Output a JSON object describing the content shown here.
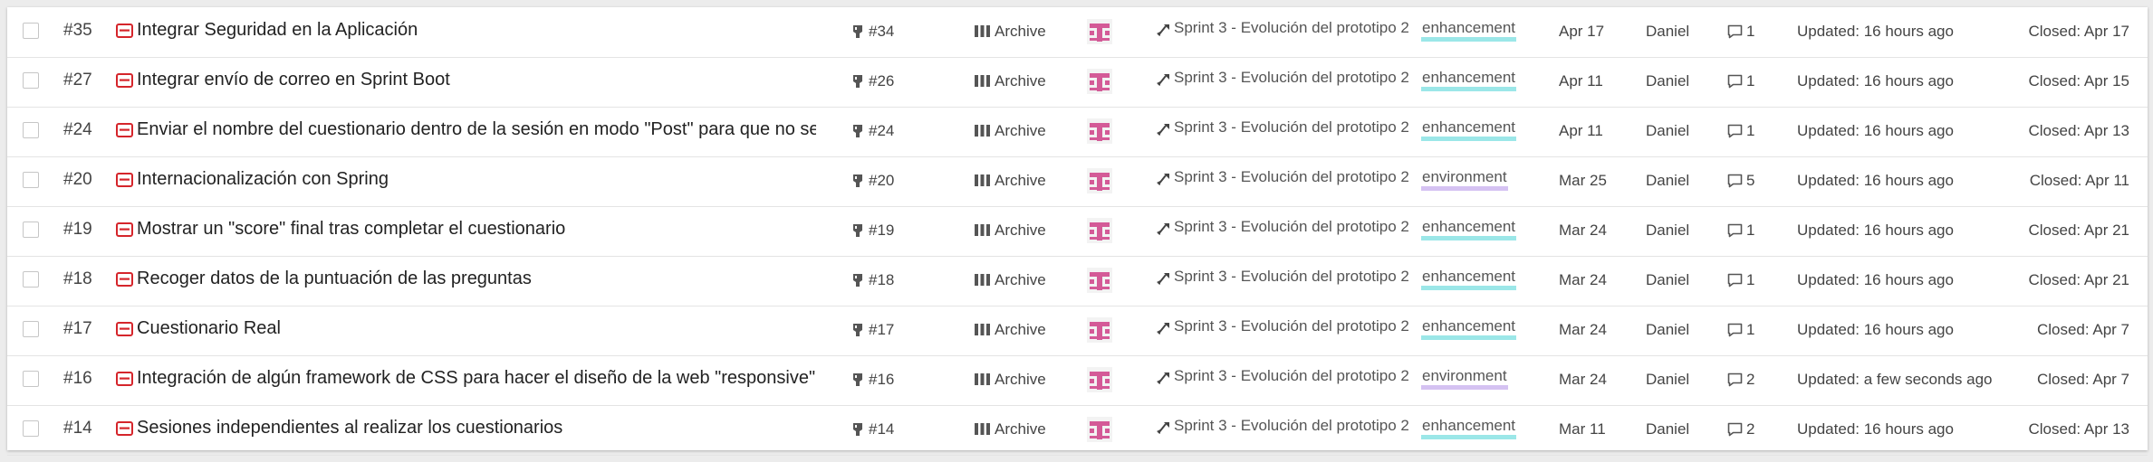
{
  "colors": {
    "issue_icon": "#d5252b",
    "label_enhancement": "#9be7e8",
    "label_environment": "#d5c2f2",
    "avatar": "#d45a97"
  },
  "icons": {
    "issue": "issue-icon",
    "branch": "branch-icon",
    "column": "board-column-icon",
    "milestone": "milestone-icon",
    "comment": "comment-icon"
  },
  "issues": [
    {
      "number": "#35",
      "title": "Integrar Seguridad en la Aplicación",
      "branch": "#34",
      "column": "Archive",
      "milestone": "Sprint 3 - Evolución del prototipo 2",
      "label": "enhancement",
      "date": "Apr 17",
      "author": "Daniel",
      "comments": "1",
      "updated": "Updated: 16 hours ago",
      "closed": "Closed: Apr 17"
    },
    {
      "number": "#27",
      "title": "Integrar envío de correo en Sprint Boot",
      "branch": "#26",
      "column": "Archive",
      "milestone": "Sprint 3 - Evolución del prototipo 2",
      "label": "enhancement",
      "date": "Apr 11",
      "author": "Daniel",
      "comments": "1",
      "updated": "Updated: 16 hours ago",
      "closed": "Closed: Apr 15"
    },
    {
      "number": "#24",
      "title": "Enviar el nombre del cuestionario dentro de la sesión en modo \"Post\" para que no se",
      "branch": "#24",
      "column": "Archive",
      "milestone": "Sprint 3 - Evolución del prototipo 2",
      "label": "enhancement",
      "date": "Apr 11",
      "author": "Daniel",
      "comments": "1",
      "updated": "Updated: 16 hours ago",
      "closed": "Closed: Apr 13"
    },
    {
      "number": "#20",
      "title": "Internacionalización con Spring",
      "branch": "#20",
      "column": "Archive",
      "milestone": "Sprint 3 - Evolución del prototipo 2",
      "label": "environment",
      "date": "Mar 25",
      "author": "Daniel",
      "comments": "5",
      "updated": "Updated: 16 hours ago",
      "closed": "Closed: Apr 11"
    },
    {
      "number": "#19",
      "title": "Mostrar un \"score\" final tras completar el cuestionario",
      "branch": "#19",
      "column": "Archive",
      "milestone": "Sprint 3 - Evolución del prototipo 2",
      "label": "enhancement",
      "date": "Mar 24",
      "author": "Daniel",
      "comments": "1",
      "updated": "Updated: 16 hours ago",
      "closed": "Closed: Apr 21"
    },
    {
      "number": "#18",
      "title": "Recoger datos de la puntuación de las preguntas",
      "branch": "#18",
      "column": "Archive",
      "milestone": "Sprint 3 - Evolución del prototipo 2",
      "label": "enhancement",
      "date": "Mar 24",
      "author": "Daniel",
      "comments": "1",
      "updated": "Updated: 16 hours ago",
      "closed": "Closed: Apr 21"
    },
    {
      "number": "#17",
      "title": "Cuestionario Real",
      "branch": "#17",
      "column": "Archive",
      "milestone": "Sprint 3 - Evolución del prototipo 2",
      "label": "enhancement",
      "date": "Mar 24",
      "author": "Daniel",
      "comments": "1",
      "updated": "Updated: 16 hours ago",
      "closed": "Closed: Apr 7"
    },
    {
      "number": "#16",
      "title": "Integración de algún framework de CSS para hacer el diseño de la web \"responsive\"",
      "branch": "#16",
      "column": "Archive",
      "milestone": "Sprint 3 - Evolución del prototipo 2",
      "label": "environment",
      "date": "Mar 24",
      "author": "Daniel",
      "comments": "2",
      "updated": "Updated: a few seconds ago",
      "closed": "Closed: Apr 7"
    },
    {
      "number": "#14",
      "title": "Sesiones independientes al realizar los cuestionarios",
      "branch": "#14",
      "column": "Archive",
      "milestone": "Sprint 3 - Evolución del prototipo 2",
      "label": "enhancement",
      "date": "Mar 11",
      "author": "Daniel",
      "comments": "2",
      "updated": "Updated: 16 hours ago",
      "closed": "Closed: Apr 13"
    }
  ]
}
